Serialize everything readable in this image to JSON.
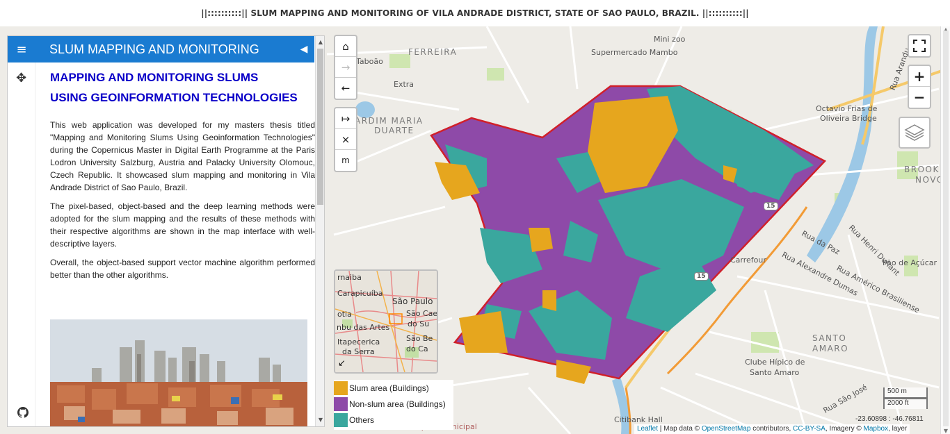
{
  "page": {
    "title": "||::::::::::|| SLUM MAPPING AND MONITORING OF VILA ANDRADE DISTRICT, STATE OF SAO PAULO, BRAZIL. ||::::::::::||"
  },
  "sidebar": {
    "header_title": "SLUM MAPPING AND MONITORING",
    "menu_icon": "hamburger-icon",
    "collapse_icon": "caret-left-icon",
    "move_icon": "move-arrows-icon",
    "github_icon": "github-icon",
    "heading_line1": "MAPPING AND MONITORING SLUMS",
    "heading_line2": "USING GEOINFORMATION TECHNOLOGIES",
    "paragraphs": [
      "This web application was developed for my masters thesis titled \"Mapping and Monitoring Slums Using Geoinformation Technologies\" during the Copernicus Master in Digital Earth Programme at the Paris Lodron University Salzburg, Austria and Palacky University Olomouc, Czech Republic. It showcased slum mapping and monitoring in Vila Andrade District of Sao Paulo, Brazil.",
      "The pixel-based, object-based and the deep learning methods were adopted for the slum mapping and the results of these methods with their respective algorithms are shown in the map interface with well-descriptive layers.",
      "Overall, the object-based support vector machine algorithm performed better than the other algorithms."
    ]
  },
  "map_controls": {
    "nav": [
      {
        "icon": "home-icon",
        "glyph": "⌂"
      },
      {
        "icon": "arrow-right-icon",
        "glyph": "→"
      },
      {
        "icon": "arrow-left-icon",
        "glyph": "←"
      }
    ],
    "measure": [
      {
        "icon": "measure-distance-icon",
        "glyph": "↦"
      },
      {
        "icon": "clear-icon",
        "glyph": "×"
      },
      {
        "icon": "unit-m-icon",
        "glyph": "m"
      }
    ],
    "fullscreen_icon": "fullscreen-icon",
    "zoom_in": "+",
    "zoom_out": "−",
    "layers_icon": "layers-icon"
  },
  "map_labels": {
    "ferreira": "FERREIRA",
    "taboao": "Taboão",
    "extra": "Extra",
    "supermercado": "Supermercado Mambo",
    "mini_zoo": "Mini zoo",
    "jardim1": "ARDIM MARIA",
    "jardim2": "DUARTE",
    "octavio1": "Octavio Frias de",
    "octavio2": "Oliveira Bridge",
    "brooklin1": "BROOKL",
    "brooklin2": "NOVO",
    "carrefour": "Carrefour",
    "pao": "Pão de Açúcar",
    "rua_paz": "Rua da Paz",
    "rua_henri": "Rua Henri Dunant",
    "rua_alexandre": "Rua Alexandre Dumas",
    "rua_americo": "Rua Américo Brasiliense",
    "santo_amaro1": "SANTO",
    "santo_amaro2": "AMARO",
    "clube1": "Clube Hípico de",
    "clube2": "Santo Amaro",
    "rua_sao_jose": "Rua São José",
    "citibank": "Citibank Hall",
    "hospital": "Hospital Municipal",
    "rua_aranda": "Rua Arandu",
    "route15a": "15",
    "route15b": "15"
  },
  "minimap": {
    "labels": [
      "rnaiba",
      "Carapicuíba",
      "São Paulo",
      "otia",
      "São Cae",
      "do Su",
      "nbu das Artes",
      "Itapecerica",
      "da Serra",
      "São Be",
      "do Ca"
    ],
    "toggle_icon": "minimap-collapse-icon"
  },
  "legend": {
    "items": [
      {
        "label": "Slum area (Buildings)",
        "color": "#e6a61e"
      },
      {
        "label": "Non-slum area (Buildings)",
        "color": "#8e4aa8"
      },
      {
        "label": "Others",
        "color": "#3aa79e"
      }
    ]
  },
  "scale": {
    "metric": "500 m",
    "imperial": "2000 ft"
  },
  "coordinates": "-23.60898 : -46.76811",
  "attribution": {
    "leaflet": "Leaflet",
    "sep1": " | Map data © ",
    "osm": "OpenStreetMap",
    "sep2": " contributors, ",
    "license": "CC-BY-SA",
    "sep3": ", Imagery © ",
    "mapbox": "Mapbox",
    "tail": ", layer"
  },
  "colors": {
    "header_blue": "#1a7bd1",
    "heading_blue": "#0b00c8",
    "boundary_red": "#d0202a"
  }
}
